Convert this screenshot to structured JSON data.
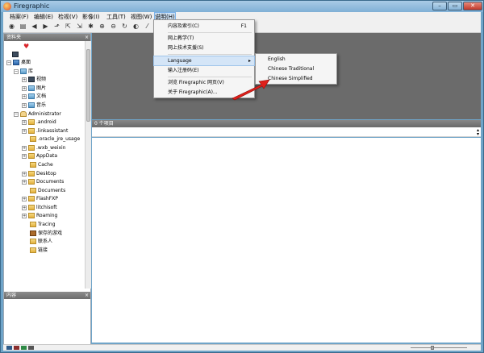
{
  "window": {
    "title": "Firegraphic",
    "min_label": "–",
    "max_label": "▭",
    "close_label": "✕"
  },
  "menubar": {
    "items": [
      "档案(F)",
      "编辑(E)",
      "检视(V)",
      "影像(I)",
      "工具(T)",
      "视图(W)",
      "说明(H)"
    ]
  },
  "toolbar": {
    "icons": [
      "camera-icon",
      "printer-icon",
      "back-icon",
      "forward-icon",
      "up-icon",
      "export-icon",
      "import-icon",
      "settings-icon",
      "zoom-in-icon",
      "zoom-out-icon",
      "rotate-icon",
      "half-icon",
      "wand-icon"
    ]
  },
  "left_pane": {
    "folders_title": "资料夹",
    "content_title": "内容",
    "close_label": "×",
    "tree": [
      {
        "label": "",
        "icon": "heart-icon"
      },
      {
        "label": "",
        "icon": "media-icon"
      },
      {
        "label": "桌面",
        "icon": "desktop-icon",
        "expander": "−"
      },
      {
        "label": "库",
        "icon": "library-icon",
        "expander": "−"
      },
      {
        "label": "视频",
        "icon": "folder-icon",
        "expander": "+"
      },
      {
        "label": "图片",
        "icon": "folder-icon",
        "expander": "+"
      },
      {
        "label": "文档",
        "icon": "folder-icon",
        "expander": "+"
      },
      {
        "label": "音乐",
        "icon": "folder-icon",
        "expander": "+"
      },
      {
        "label": "Administrator",
        "icon": "user-icon",
        "expander": "−"
      },
      {
        "label": ".android",
        "icon": "folder-icon",
        "expander": "+"
      },
      {
        "label": ".linkassistant",
        "icon": "folder-icon",
        "expander": "+"
      },
      {
        "label": ".oracle_jre_usage",
        "icon": "folder-icon",
        "expander": ""
      },
      {
        "label": ".wxb_weixin",
        "icon": "folder-icon",
        "expander": "+"
      },
      {
        "label": "AppData",
        "icon": "folder-icon",
        "expander": "+"
      },
      {
        "label": "Cache",
        "icon": "folder-icon",
        "expander": ""
      },
      {
        "label": "Desktop",
        "icon": "folder-icon",
        "expander": "+"
      },
      {
        "label": "Documents",
        "icon": "folder-icon",
        "expander": "+"
      },
      {
        "label": "Documents",
        "icon": "folder-icon",
        "expander": ""
      },
      {
        "label": "FlashFXP",
        "icon": "folder-icon",
        "expander": "+"
      },
      {
        "label": "litchisoft",
        "icon": "folder-icon",
        "expander": "+"
      },
      {
        "label": "Roaming",
        "icon": "folder-icon",
        "expander": "+"
      },
      {
        "label": "Tracing",
        "icon": "folder-icon",
        "expander": ""
      },
      {
        "label": "保存的游戏",
        "icon": "game-icon",
        "expander": ""
      },
      {
        "label": "联系人",
        "icon": "folder-icon",
        "expander": ""
      },
      {
        "label": "链接",
        "icon": "folder-icon",
        "expander": ""
      }
    ]
  },
  "right_pane": {
    "header": "0 个项目",
    "scroll_up": "▴",
    "scroll_down": "▾"
  },
  "help_menu": {
    "items": [
      {
        "label": "内容及索引(C)",
        "shortcut": "F1"
      },
      {
        "label": "网上教学(T)",
        "shortcut": ""
      },
      {
        "label": "网上技术支援(S)",
        "shortcut": ""
      },
      {
        "label": "Language",
        "shortcut": "",
        "submenu": "▸"
      },
      {
        "label": "输入注册码(E)",
        "shortcut": ""
      },
      {
        "label": "浏览 Firegraphic 网页(V)",
        "shortcut": ""
      },
      {
        "label": "关于 Firegraphic(A)...",
        "shortcut": ""
      }
    ]
  },
  "language_submenu": {
    "items": [
      "English",
      "Chinese Traditional",
      "Chinese Simplified"
    ]
  },
  "colors": {
    "highlight": "#d4e5f7",
    "annotation_arrow": "#e0201b",
    "title_gradient": "#7fb0d6"
  }
}
